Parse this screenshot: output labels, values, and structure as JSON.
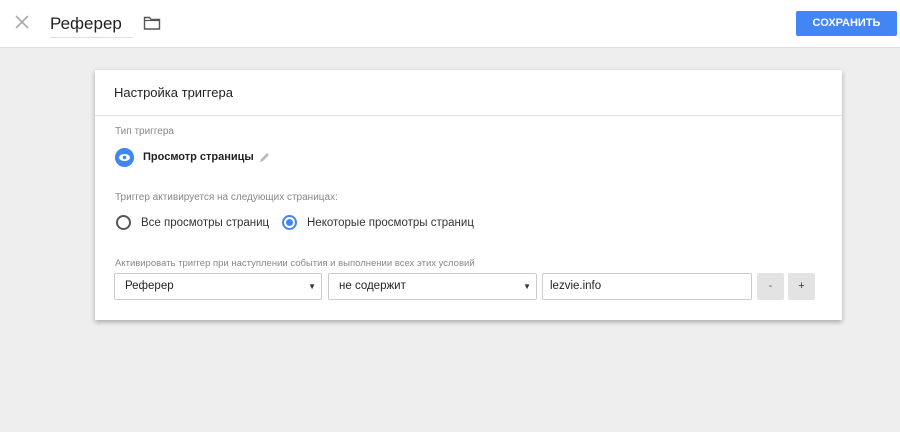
{
  "header": {
    "title": "Реферер",
    "save_label": "СОХРАНИТЬ"
  },
  "card": {
    "title": "Настройка триггера",
    "type_label": "Тип триггера",
    "type_value": "Просмотр страницы",
    "pages_label": "Триггер активируется на следующих страницах:",
    "radio_all": "Все просмотры страниц",
    "radio_some": "Некоторые просмотры страниц",
    "condition_label": "Активировать триггер при наступлении события и выполнении всех этих условий",
    "condition": {
      "variable": "Реферер",
      "operator": "не содержит",
      "value": "lezvie.info",
      "minus": "-",
      "plus": "+",
      "arrow": "▼"
    }
  },
  "colors": {
    "accent": "#4285f4"
  }
}
